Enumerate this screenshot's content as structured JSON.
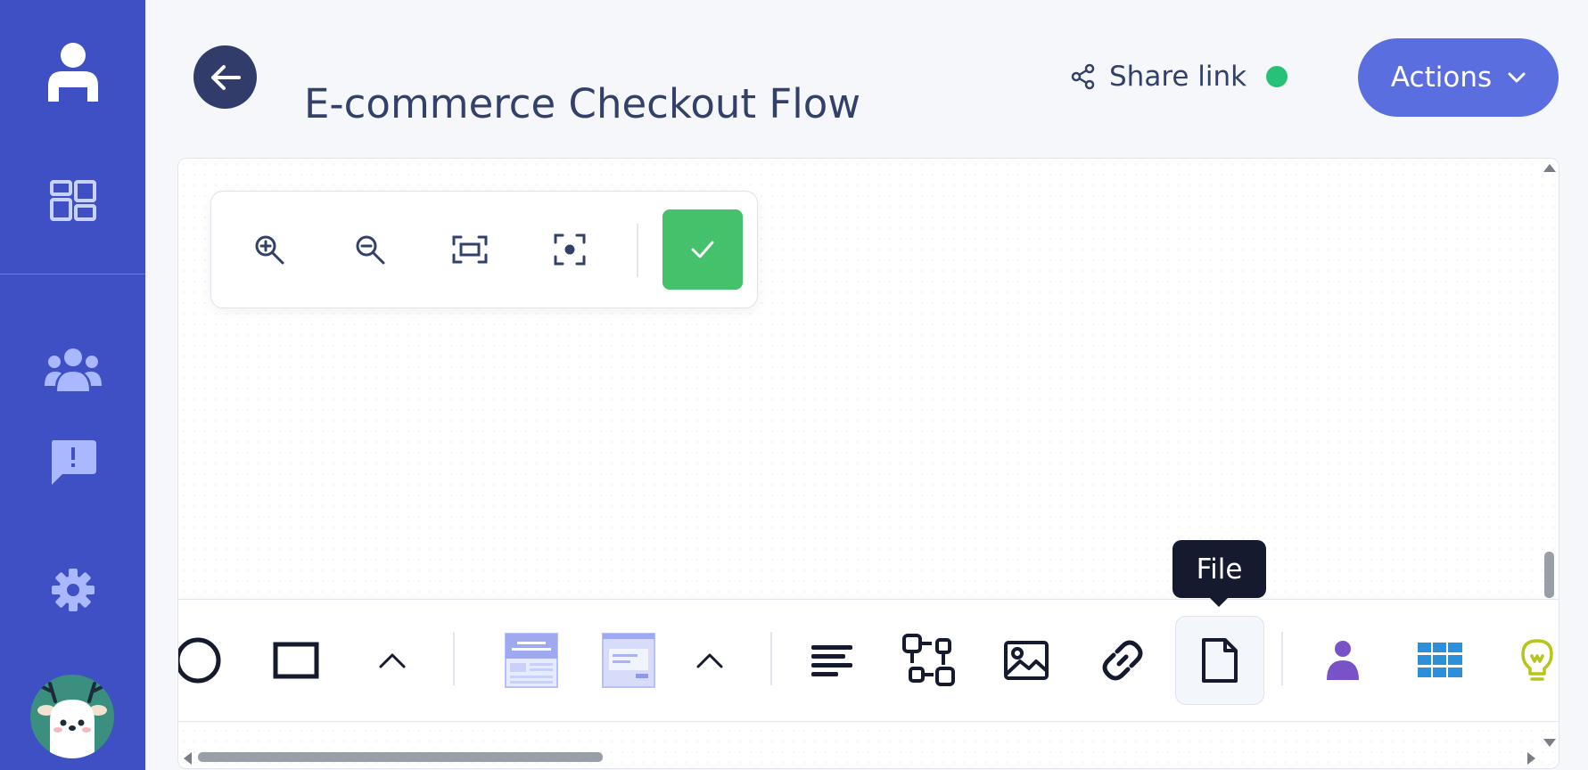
{
  "header": {
    "title": "E-commerce Checkout Flow",
    "share_label": "Share link",
    "actions_label": "Actions"
  },
  "sidebar": {
    "items": [
      {
        "icon": "user-laptop-icon"
      },
      {
        "icon": "dashboard-grid-icon"
      },
      {
        "icon": "team-icon"
      },
      {
        "icon": "feedback-icon"
      },
      {
        "icon": "gear-icon"
      }
    ],
    "avatar": "deer-avatar"
  },
  "zoom_panel": {
    "buttons": [
      "zoom-in-icon",
      "zoom-out-icon",
      "fit-screen-icon",
      "center-focus-icon",
      "check-icon"
    ]
  },
  "toolbar": {
    "tooltip": "File",
    "items": [
      "circle-shape-icon",
      "rectangle-shape-icon",
      "chevron-up-icon",
      "wireframe-template-icon",
      "dialog-template-icon",
      "chevron-up-icon",
      "text-align-icon",
      "flow-connector-icon",
      "image-icon",
      "link-icon",
      "file-icon",
      "person-icon",
      "table-icon",
      "lightbulb-icon"
    ]
  },
  "colors": {
    "sidebar": "#3f4fc4",
    "accent": "#5b6ee0",
    "confirm": "#45c16b",
    "status": "#27c177",
    "tooltip": "#161a2e"
  }
}
